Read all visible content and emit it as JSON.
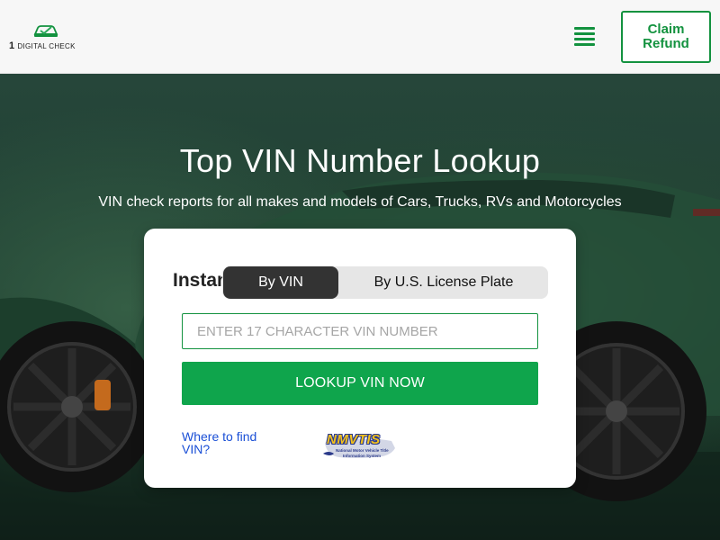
{
  "header": {
    "logo_number": "1",
    "logo_text": "DIGITAL CHECK",
    "claim_button": "Claim Refund"
  },
  "hero": {
    "title": "Top VIN Number Lookup",
    "subtitle": "VIN check reports for all makes and models of Cars, Trucks, RVs and Motorcycles"
  },
  "card": {
    "heading": "Instant VIN Check",
    "tabs": [
      {
        "label": "By VIN",
        "active": true
      },
      {
        "label": "By U.S. License Plate",
        "active": false
      }
    ],
    "vin_input": {
      "placeholder": "ENTER 17 CHARACTER VIN NUMBER",
      "value": ""
    },
    "lookup_button": "LOOKUP VIN NOW",
    "where_link": "Where to find VIN?",
    "badge": {
      "name": "NMVTIS",
      "line1": "National Motor Vehicle Title",
      "line2": "Information System"
    }
  },
  "colors": {
    "brand_green": "#13923f",
    "button_green": "#0fa54c",
    "link_blue": "#1a4fd6",
    "active_tab": "#333333"
  },
  "icons": [
    "car-logo-icon",
    "hamburger-menu-icon",
    "nmvtis-map-icon"
  ]
}
